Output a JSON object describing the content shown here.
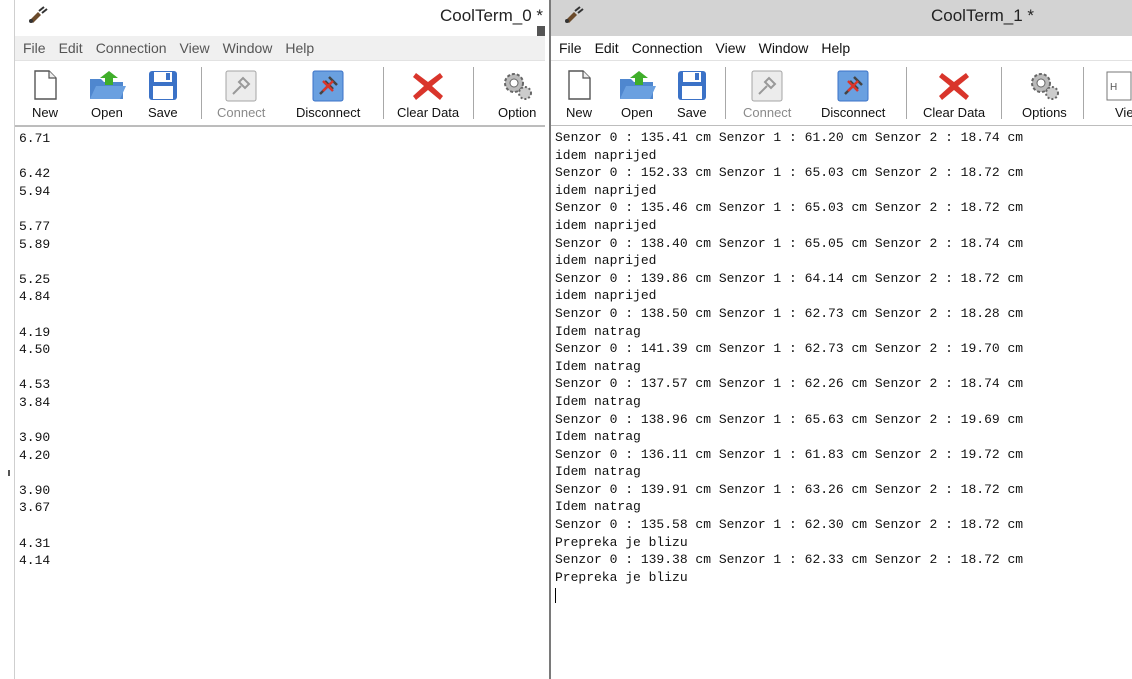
{
  "windows": [
    {
      "title": "CoolTerm_0 *",
      "menu": [
        "File",
        "Edit",
        "Connection",
        "View",
        "Window",
        "Help"
      ],
      "toolbar": {
        "new": "New",
        "open": "Open",
        "save": "Save",
        "connect": "Connect",
        "disconnect": "Disconnect",
        "clear": "Clear Data",
        "options": "Option"
      },
      "lines": [
        "6.71",
        "",
        "6.42",
        "5.94",
        "",
        "5.77",
        "5.89",
        "",
        "5.25",
        "4.84",
        "",
        "4.19",
        "4.50",
        "",
        "4.53",
        "3.84",
        "",
        "3.90",
        "4.20",
        "",
        "3.90",
        "3.67",
        "",
        "4.31",
        "4.14"
      ]
    },
    {
      "title": "CoolTerm_1 *",
      "menu": [
        "File",
        "Edit",
        "Connection",
        "View",
        "Window",
        "Help"
      ],
      "toolbar": {
        "new": "New",
        "open": "Open",
        "save": "Save",
        "connect": "Connect",
        "disconnect": "Disconnect",
        "clear": "Clear Data",
        "options": "Options",
        "view": "Vie"
      },
      "lines": [
        "Senzor 0 : 135.41 cm Senzor 1 : 61.20 cm Senzor 2 : 18.74 cm",
        "idem naprijed",
        "Senzor 0 : 152.33 cm Senzor 1 : 65.03 cm Senzor 2 : 18.72 cm",
        "idem naprijed",
        "Senzor 0 : 135.46 cm Senzor 1 : 65.03 cm Senzor 2 : 18.72 cm",
        "idem naprijed",
        "Senzor 0 : 138.40 cm Senzor 1 : 65.05 cm Senzor 2 : 18.74 cm",
        "idem naprijed",
        "Senzor 0 : 139.86 cm Senzor 1 : 64.14 cm Senzor 2 : 18.72 cm",
        "idem naprijed",
        "Senzor 0 : 138.50 cm Senzor 1 : 62.73 cm Senzor 2 : 18.28 cm",
        "Idem natrag",
        "Senzor 0 : 141.39 cm Senzor 1 : 62.73 cm Senzor 2 : 19.70 cm",
        "Idem natrag",
        "Senzor 0 : 137.57 cm Senzor 1 : 62.26 cm Senzor 2 : 18.74 cm",
        "Idem natrag",
        "Senzor 0 : 138.96 cm Senzor 1 : 65.63 cm Senzor 2 : 19.69 cm",
        "Idem natrag",
        "Senzor 0 : 136.11 cm Senzor 1 : 61.83 cm Senzor 2 : 19.72 cm",
        "Idem natrag",
        "Senzor 0 : 139.91 cm Senzor 1 : 63.26 cm Senzor 2 : 18.72 cm",
        "Idem natrag",
        "Senzor 0 : 135.58 cm Senzor 1 : 62.30 cm Senzor 2 : 18.72 cm",
        "Prepreka je blizu",
        "Senzor 0 : 139.38 cm Senzor 1 : 62.33 cm Senzor 2 : 18.72 cm",
        "Prepreka je blizu"
      ]
    }
  ],
  "icons": {
    "app": "plug-icon",
    "new": "new-file-icon",
    "open": "open-folder-icon",
    "save": "floppy-disk-icon",
    "connect": "connect-plug-icon",
    "disconnect": "disconnect-plug-icon",
    "clear": "red-x-icon",
    "options": "gears-icon"
  },
  "colors": {
    "clear_red": "#d9352b",
    "open_green": "#3fae2a",
    "save_blue": "#3b72c7",
    "titlebar_inactive": "#d3d3d3"
  }
}
